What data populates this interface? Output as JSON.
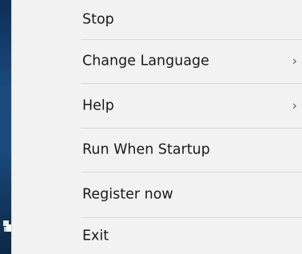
{
  "menu": {
    "items": [
      {
        "label": "Stop",
        "has_submenu": false
      },
      {
        "label": "Change Language",
        "has_submenu": true
      },
      {
        "label": "Help",
        "has_submenu": true
      },
      {
        "label": "Run When Startup",
        "has_submenu": false
      },
      {
        "label": "Register now",
        "has_submenu": false
      },
      {
        "label": "Exit",
        "has_submenu": false
      }
    ],
    "submenu_glyph": "›"
  },
  "colors": {
    "menu_background": "#f2f2f2",
    "text": "#1a1a1a",
    "separator": "#d9d9d9",
    "desktop_strip": "#184a7c"
  },
  "icons": [
    "app-tray-icon",
    "chevron-right-icon"
  ]
}
